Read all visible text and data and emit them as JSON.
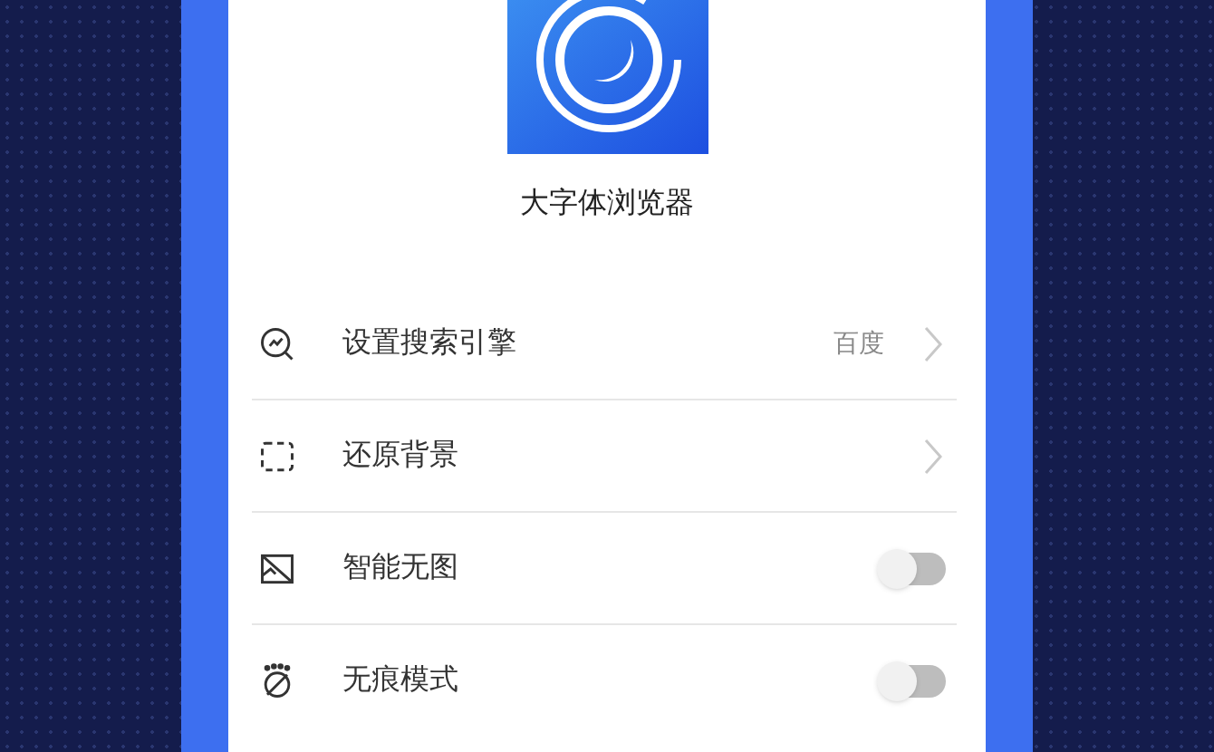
{
  "app": {
    "name": "大字体浏览器"
  },
  "settings": [
    {
      "kind": "link",
      "label": "设置搜索引擎",
      "value": "百度"
    },
    {
      "kind": "link",
      "label": "还原背景"
    },
    {
      "kind": "toggle",
      "label": "智能无图",
      "on": false
    },
    {
      "kind": "toggle",
      "label": "无痕模式",
      "on": false
    }
  ]
}
